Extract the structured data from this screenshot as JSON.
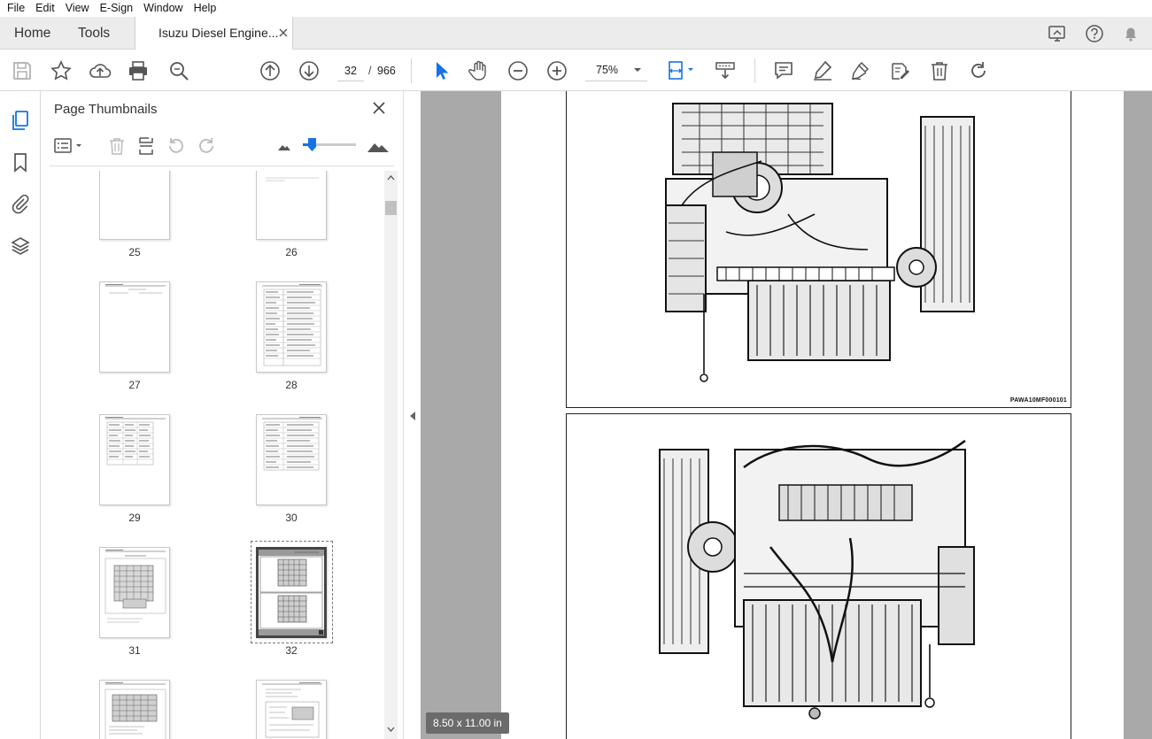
{
  "menu": [
    "File",
    "Edit",
    "View",
    "E-Sign",
    "Window",
    "Help"
  ],
  "tabs": {
    "home": "Home",
    "tools": "Tools",
    "document": "Isuzu Diesel Engine..."
  },
  "toolbar": {
    "current_page": "32",
    "slash": "/",
    "total_pages": "966",
    "zoom": "75%"
  },
  "panel": {
    "title": "Page Thumbnails",
    "thumbnails": [
      {
        "label": "25",
        "selected": false
      },
      {
        "label": "26",
        "selected": false
      },
      {
        "label": "27",
        "selected": false
      },
      {
        "label": "28",
        "selected": false
      },
      {
        "label": "29",
        "selected": false
      },
      {
        "label": "30",
        "selected": false
      },
      {
        "label": "31",
        "selected": false
      },
      {
        "label": "32",
        "selected": true
      }
    ]
  },
  "document": {
    "figure_code": "PAWA10MF000101",
    "page_size": "8.50 x 11.00 in"
  },
  "colors": {
    "accent": "#1473e6",
    "doc_background": "#a9a9a9",
    "icon_gray": "#5a5a5a"
  }
}
